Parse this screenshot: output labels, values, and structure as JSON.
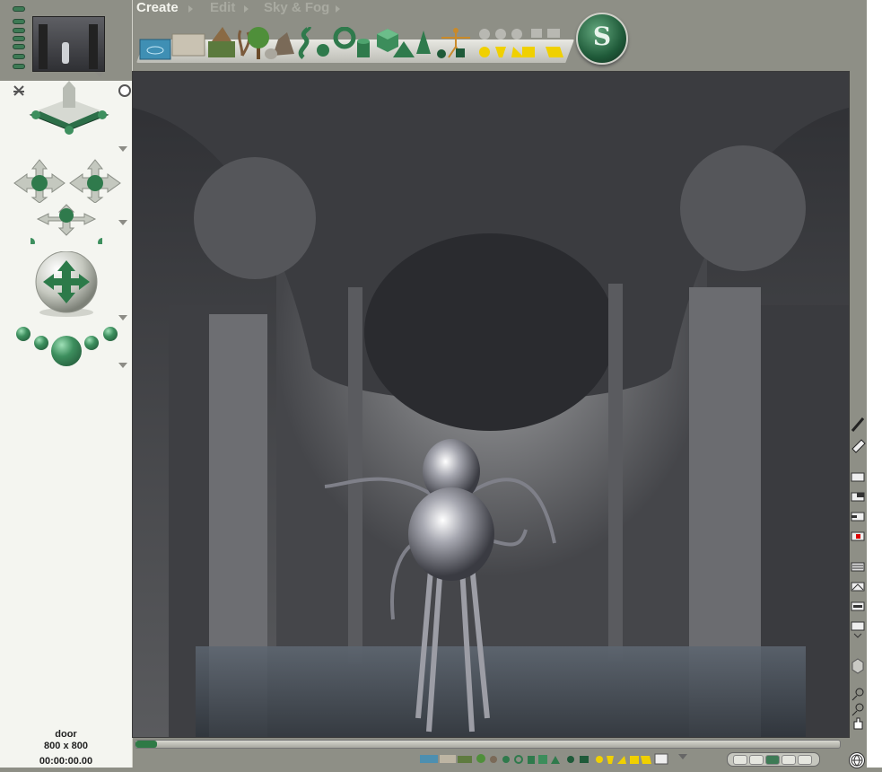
{
  "menu": {
    "create": "Create",
    "edit": "Edit",
    "sky_fog": "Sky & Fog"
  },
  "scene": {
    "name": "door",
    "size": "800 x 800",
    "time": "00:00:00.00"
  },
  "icons": {
    "toolbar": [
      "water-plane-icon",
      "ground-plane-icon",
      "terrain-icon",
      "plant-icon",
      "tree-icon",
      "rock-icon",
      "stone-icon",
      "torus-knot-icon",
      "torus-icon",
      "cylinder-icon",
      "cube-icon",
      "pyramid-icon",
      "cone-icon",
      "figure-icon",
      "sphere-light-icon",
      "spot-light-icon",
      "cube-light-icon"
    ],
    "right": [
      "pencil-icon",
      "eraser-icon",
      "render-icon",
      "render-area-icon",
      "render-region-icon",
      "record-icon",
      "options-icon",
      "texture-icon",
      "film-icon",
      "display-icon",
      "box-object-icon",
      "zoom-in-icon",
      "zoom-out-icon",
      "pan-hand-icon"
    ]
  },
  "colors": {
    "accent": "#3d7a55",
    "chrome": "#8e8f86",
    "panel": "#f4f5f0"
  }
}
